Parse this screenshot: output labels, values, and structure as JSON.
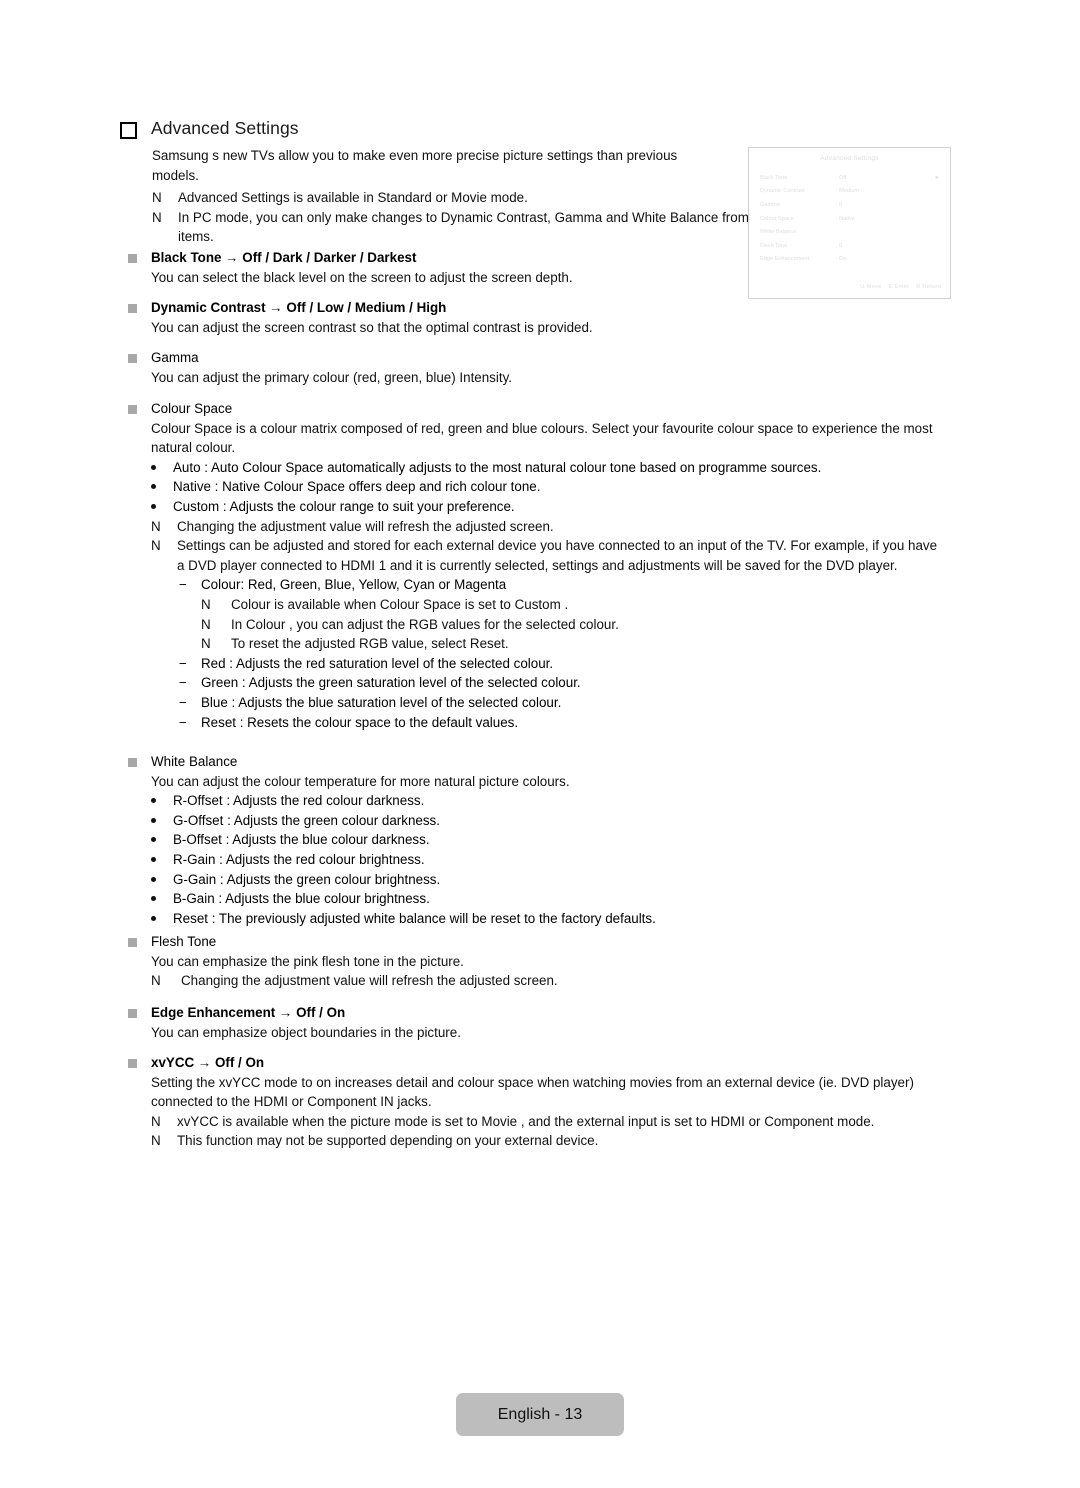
{
  "page": {
    "heading": "Advanced Settings",
    "heading_icon": "hollow-square-bullet",
    "footer_label": "English - 13"
  },
  "intro": {
    "paragraph": "Samsung s new TVs allow you to make even more precise picture settings than previous models.",
    "notes": [
      {
        "marker": "N",
        "text": "Advanced Settings  is available in Standard  or Movie  mode."
      },
      {
        "marker": "N",
        "text": "In PC mode, you can only make changes to Dynamic Contrast, Gamma   and White Balance  from among the Advanced Settings   items."
      }
    ]
  },
  "sections": [
    {
      "id": "black-tone",
      "heading": "Black Tone → Off / Dark / Darker / Darkest",
      "bold": true,
      "body": "You can select the black level on the screen to adjust the screen depth."
    },
    {
      "id": "dynamic-contrast",
      "heading": "Dynamic Contrast → Off / Low / Medium / High",
      "bold": true,
      "body": "You can adjust the screen contrast so that the optimal contrast is provided."
    },
    {
      "id": "gamma",
      "heading": "Gamma",
      "bold": false,
      "body": "You can adjust the primary colour (red, green, blue) Intensity."
    },
    {
      "id": "colour-space",
      "heading": "Colour Space",
      "bold": false,
      "body": "Colour Space is a colour matrix composed of red, green and blue colours. Select your favourite colour space to experience the most natural colour."
    },
    {
      "id": "white-balance",
      "heading": "White Balance",
      "bold": false,
      "body": "You can adjust the colour temperature for more natural picture colours."
    },
    {
      "id": "flesh-tone",
      "heading": "Flesh Tone",
      "bold": false,
      "body": "You can emphasize the pink  flesh tone  in the picture."
    },
    {
      "id": "edge-enhancement",
      "heading": "Edge Enhancement → Off / On",
      "bold": true,
      "body": "You can emphasize object boundaries in the picture."
    },
    {
      "id": "xvycc",
      "heading": "xvYCC → Off / On",
      "bold": true,
      "body": "Setting the xvYCC mode to on increases detail and colour space when watching movies from an external device (ie. DVD player) connected to the HDMI or Component IN jacks."
    }
  ],
  "colour_space_items": [
    {
      "bullet": "•",
      "text": "Auto : Auto Colour Space automatically adjusts to the most natural colour tone based on programme sources."
    },
    {
      "bullet": "•",
      "text": "Native : Native Colour Space offers deep and rich colour tone."
    },
    {
      "bullet": "•",
      "text": "Custom : Adjusts the colour range to suit your preference."
    }
  ],
  "colour_space_notes": [
    {
      "marker": "N",
      "text": "Changing the adjustment value will refresh the adjusted screen."
    },
    {
      "marker": "N",
      "text": "Settings can be adjusted and stored for each external device you have connected to an input of the TV. For example, if you have a DVD player connected to HDMI 1 and it is currently selected, settings and adjustments will be saved for the DVD player."
    }
  ],
  "colour_sub_items": [
    {
      "dash": "−",
      "text": "Colour: Red, Green, Blue, Yellow, Cyan    or Magenta"
    },
    {
      "dash": "−",
      "text": "Red : Adjusts the red saturation level of the selected colour."
    },
    {
      "dash": "−",
      "text": "Green : Adjusts the green saturation level of the selected colour."
    },
    {
      "dash": "−",
      "text": "Blue : Adjusts the blue saturation level of the selected colour."
    },
    {
      "dash": "−",
      "text": "Reset : Resets the colour space to the default values."
    }
  ],
  "colour_sub_notes": [
    {
      "marker": "N",
      "text": "Colour  is available when Colour Space  is set to Custom ."
    },
    {
      "marker": "N",
      "text": "In Colour , you can adjust the RGB values for the selected colour."
    },
    {
      "marker": "N",
      "text": "To reset the adjusted RGB value, select Reset."
    }
  ],
  "white_balance_items": [
    {
      "bullet": "•",
      "text": "R-Offset : Adjusts the red colour darkness."
    },
    {
      "bullet": "•",
      "text": "G-Offset : Adjusts the green colour darkness."
    },
    {
      "bullet": "•",
      "text": "B-Offset : Adjusts the blue colour darkness."
    },
    {
      "bullet": "•",
      "text": "R-Gain : Adjusts the red colour brightness."
    },
    {
      "bullet": "•",
      "text": "G-Gain : Adjusts the green colour brightness."
    },
    {
      "bullet": "•",
      "text": "B-Gain : Adjusts the blue colour brightness."
    },
    {
      "bullet": "•",
      "text": "Reset : The previously adjusted white balance will be reset to the factory defaults."
    }
  ],
  "flesh_tone_note": {
    "marker": "N",
    "text": "Changing the adjustment value will refresh the adjusted screen."
  },
  "xvycc_notes": [
    {
      "marker": "N",
      "text": "xvYCC is available when the picture mode is set to Movie , and the external input is set to HDMI or Component mode."
    },
    {
      "marker": "N",
      "text": "This function may not be supported depending on your external device."
    }
  ],
  "osd": {
    "title": "Advanced Settings",
    "rows": [
      {
        "label": "Black Tone",
        "value": ": Off",
        "arrow": "►"
      },
      {
        "label": "Dynamic Contrast",
        "value": ": Medium",
        "arrow": ""
      },
      {
        "label": "Gamma",
        "value": ": 0",
        "arrow": ""
      },
      {
        "label": "Colour Space",
        "value": ": Native",
        "arrow": ""
      },
      {
        "label": "White Balance",
        "value": "",
        "arrow": ""
      },
      {
        "label": "Flesh Tone",
        "value": ": 0",
        "arrow": ""
      },
      {
        "label": "Edge Enhancement",
        "value": ": On",
        "arrow": ""
      }
    ],
    "footer": [
      {
        "key": "U",
        "action": "Move"
      },
      {
        "key": "E",
        "action": "Enter"
      },
      {
        "key": "R",
        "action": "Return"
      }
    ]
  }
}
